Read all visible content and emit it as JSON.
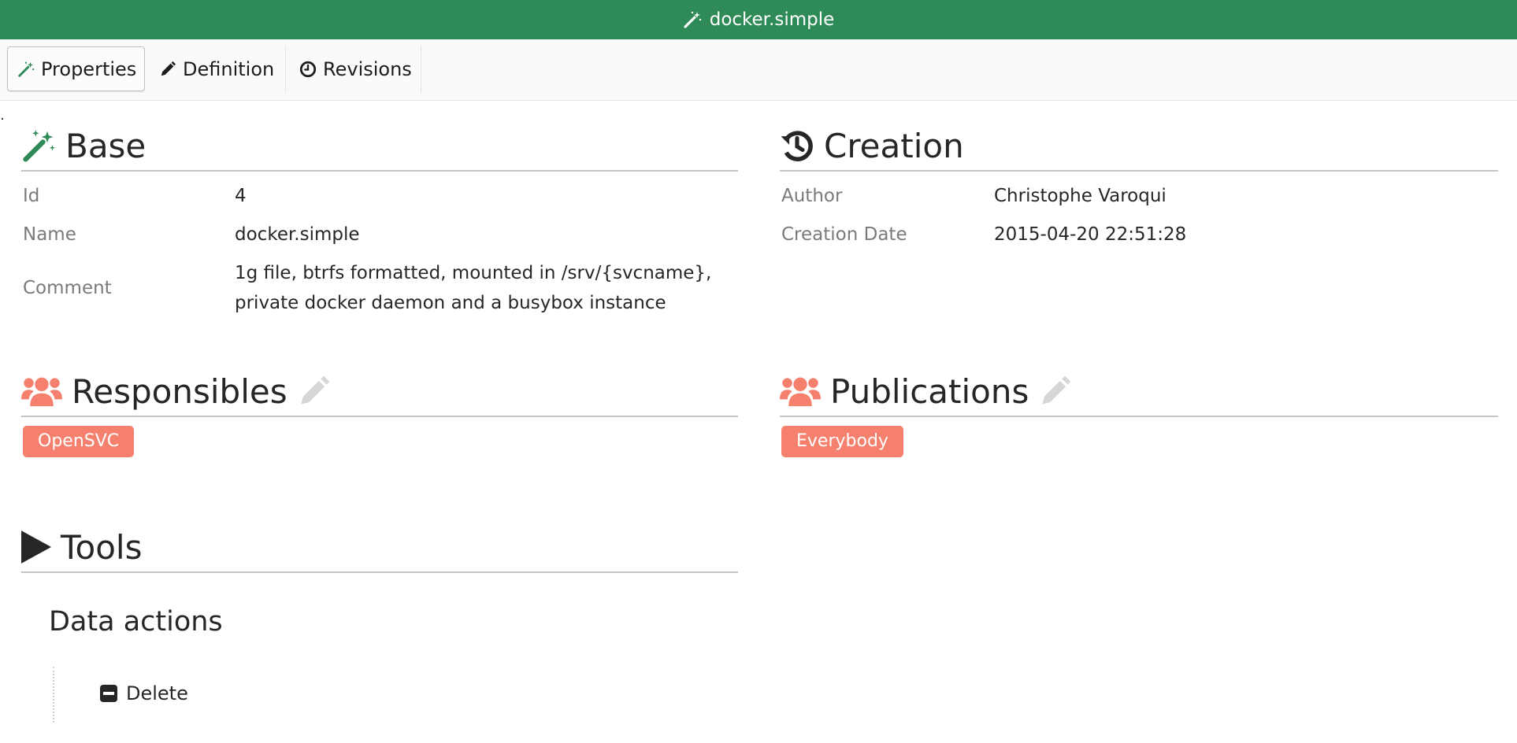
{
  "window": {
    "title": "docker.simple",
    "title_icon": "magic-wand-icon"
  },
  "tabs": [
    {
      "label": "Properties",
      "icon": "magic-wand-icon",
      "active": true
    },
    {
      "label": "Definition",
      "icon": "pencil-icon",
      "active": false
    },
    {
      "label": "Revisions",
      "icon": "clock-icon",
      "active": false
    }
  ],
  "base": {
    "title": "Base",
    "icon": "magic-wand-icon",
    "rows": [
      {
        "label": "Id",
        "value": "4"
      },
      {
        "label": "Name",
        "value": "docker.simple"
      },
      {
        "label": "Comment",
        "value_line1": "1g file, btrfs formatted, mounted in /srv/{svcname},",
        "value_line2": "private docker daemon and a busybox instance"
      }
    ]
  },
  "creation": {
    "title": "Creation",
    "icon": "history-icon",
    "rows": [
      {
        "label": "Author",
        "value": "Christophe Varoqui"
      },
      {
        "label": "Creation Date",
        "value": "2015-04-20 22:51:28"
      }
    ]
  },
  "responsibles": {
    "title": "Responsibles",
    "icon": "users-icon",
    "edit_icon": "pencil-icon",
    "groups": [
      "OpenSVC"
    ]
  },
  "publications": {
    "title": "Publications",
    "icon": "users-icon",
    "edit_icon": "pencil-icon",
    "groups": [
      "Everybody"
    ]
  },
  "tools": {
    "title": "Tools",
    "icon": "play-icon",
    "data_actions": {
      "title": "Data actions",
      "items": [
        {
          "label": "Delete",
          "icon": "minus-square-icon"
        }
      ]
    }
  },
  "colors": {
    "header": "#2e8b57",
    "accent_green": "#2e8b57",
    "badge": "#f5806e",
    "muted_icon": "#d6d6d6"
  }
}
